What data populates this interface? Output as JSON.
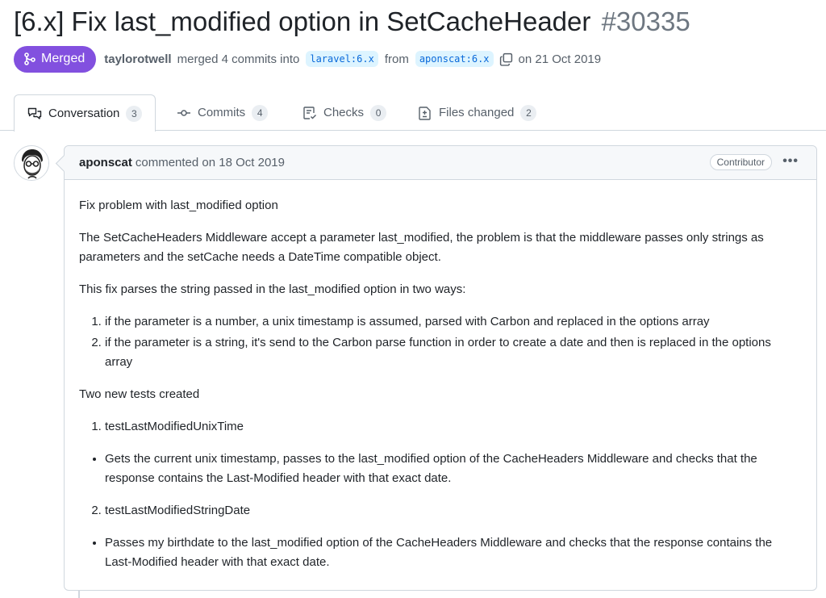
{
  "pr": {
    "title": "[6.x] Fix last_modified option in SetCacheHeader",
    "number": "#30335",
    "state": "Merged",
    "author": "taylorotwell",
    "action": "merged 4 commits into",
    "base_branch": "laravel:6.x",
    "from_text": "from",
    "head_branch": "aponscat:6.x",
    "date_text": "on 21 Oct 2019"
  },
  "tabs": [
    {
      "label": "Conversation",
      "count": "3",
      "icon": "comment-discussion-icon"
    },
    {
      "label": "Commits",
      "count": "4",
      "icon": "git-commit-icon"
    },
    {
      "label": "Checks",
      "count": "0",
      "icon": "checklist-icon"
    },
    {
      "label": "Files changed",
      "count": "2",
      "icon": "file-diff-icon"
    }
  ],
  "comment": {
    "author": "aponscat",
    "action": "commented on 18 Oct 2019",
    "role": "Contributor",
    "menu": "•••",
    "body": {
      "p1": "Fix problem with last_modified option",
      "p2": "The SetCacheHeaders Middleware accept a parameter last_modified, the problem is that the middleware passes only strings as parameters and the setCache needs a DateTime compatible object.",
      "p3": "This fix parses the string passed in the last_modified option in two ways:",
      "list1": [
        "if the parameter is a number, a unix timestamp is assumed, parsed with Carbon and replaced in the options array",
        "if the parameter is a string, it's send to the Carbon parse function in order to create a date and then is replaced in the options array"
      ],
      "p4": "Two new tests created",
      "test1": "testLastModifiedUnixTime",
      "test1_desc": "Gets the current unix timestamp, passes to the last_modified option of the CacheHeaders Middleware and checks that the response contains the Last-Modified header with that exact date.",
      "test2": "testLastModifiedStringDate",
      "test2_desc": "Passes my birthdate to the last_modified option of the CacheHeaders Middleware and checks that the response contains the Last-Modified header with that exact date."
    }
  },
  "colors": {
    "merged": "#8250df",
    "branch_bg": "#ddf4ff",
    "branch_fg": "#0969da",
    "border": "#d0d7de"
  }
}
